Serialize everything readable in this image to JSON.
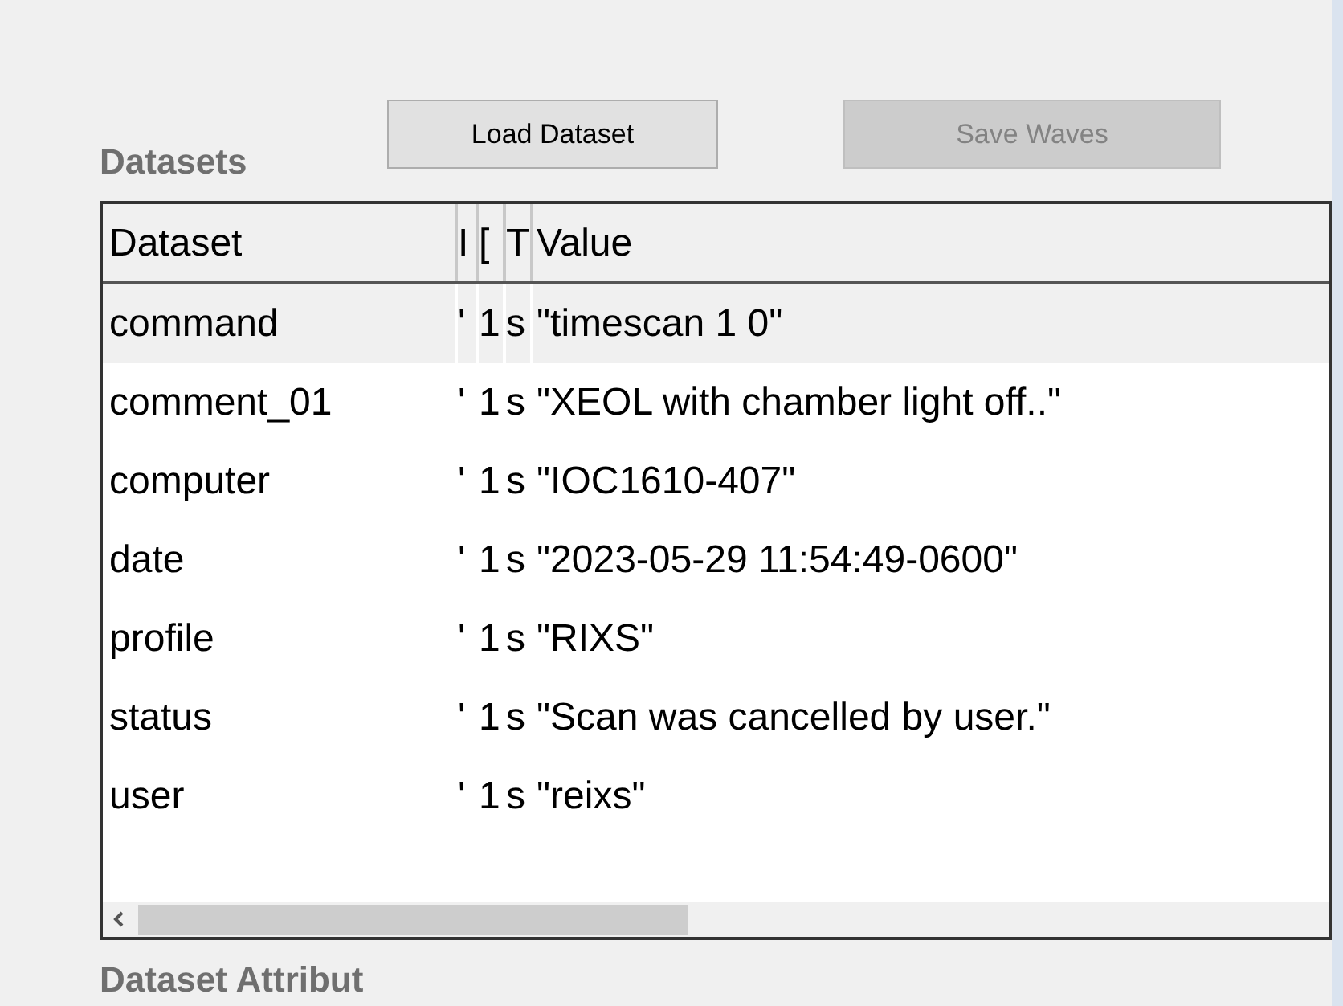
{
  "buttons": [
    {
      "label": "Load Dataset",
      "disabled": false
    },
    {
      "label": "Save Waves",
      "disabled": true
    }
  ],
  "datasets": {
    "title": "Datasets",
    "columns": [
      "Dataset",
      "I",
      "[",
      "T",
      "Value"
    ],
    "rows": [
      {
        "cells": [
          "command",
          "'",
          "1",
          "s",
          "\"timescan 1 0\""
        ],
        "selected": true
      },
      {
        "cells": [
          "comment_01",
          "'",
          "1",
          "s",
          "\"XEOL with chamber light off..\""
        ],
        "selected": false
      },
      {
        "cells": [
          "computer",
          "'",
          "1",
          "s",
          "\"IOC1610-407\""
        ],
        "selected": false
      },
      {
        "cells": [
          "date",
          "'",
          "1",
          "s",
          "\"2023-05-29 11:54:49-0600\""
        ],
        "selected": false
      },
      {
        "cells": [
          "profile",
          "'",
          "1",
          "s",
          "\"RIXS\""
        ],
        "selected": false
      },
      {
        "cells": [
          "status",
          "'",
          "1",
          "s",
          "\"Scan was cancelled by user.\""
        ],
        "selected": false
      },
      {
        "cells": [
          "user",
          "'",
          "1",
          "s",
          "\"reixs\""
        ],
        "selected": false
      }
    ]
  },
  "attributes": {
    "title": "Dataset Attribut"
  }
}
